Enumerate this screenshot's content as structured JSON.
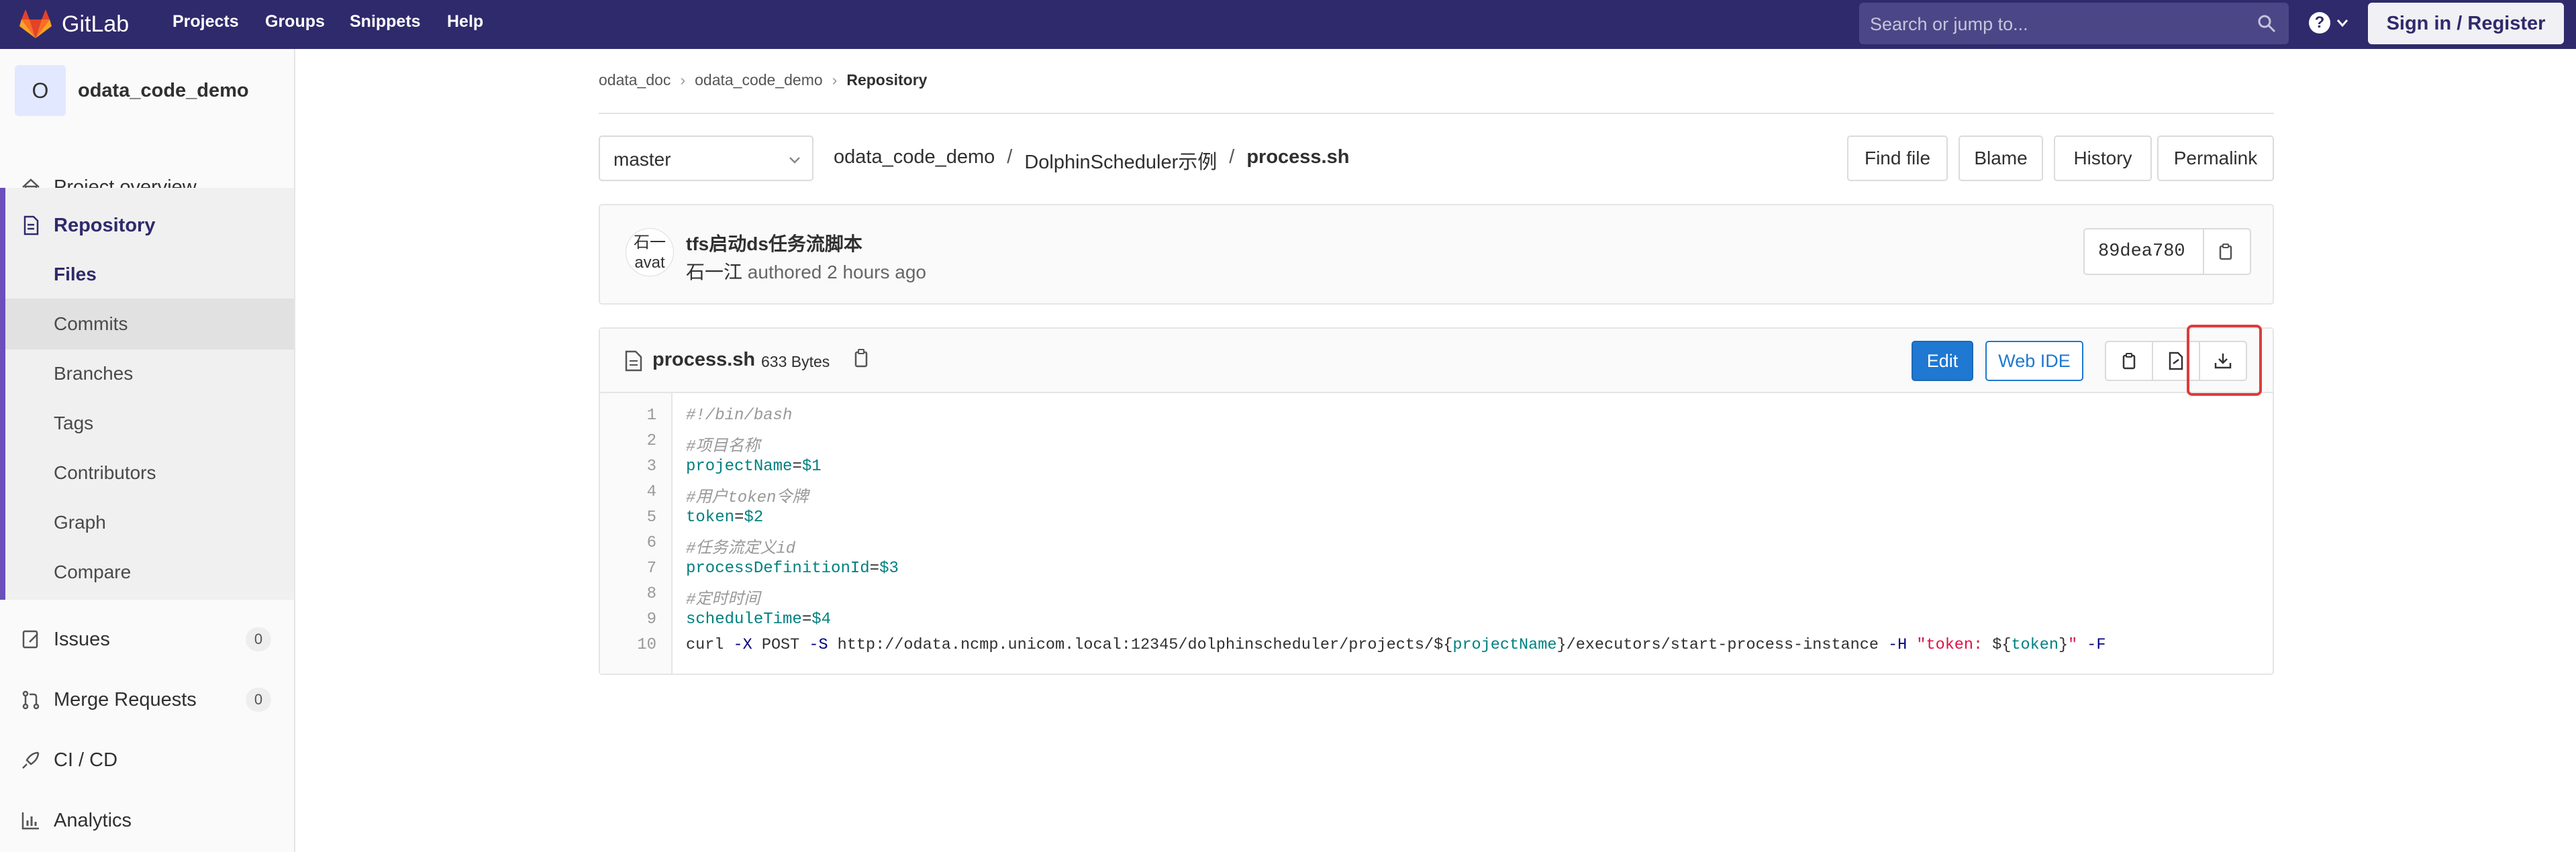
{
  "navbar": {
    "brand": "GitLab",
    "links": [
      "Projects",
      "Groups",
      "Snippets",
      "Help"
    ],
    "search_placeholder": "Search or jump to...",
    "help_glyph": "?",
    "signin_label": "Sign in / Register",
    "colors": {
      "bg": "#2f2a6b",
      "accent": "#fc6d26"
    }
  },
  "sidebar": {
    "project_initial": "O",
    "project_name": "odata_code_demo",
    "overview": "Project overview",
    "repository": "Repository",
    "repo_items": [
      "Files",
      "Commits",
      "Branches",
      "Tags",
      "Contributors",
      "Graph",
      "Compare"
    ],
    "issues": {
      "label": "Issues",
      "count": "0"
    },
    "merge_requests": {
      "label": "Merge Requests",
      "count": "0"
    },
    "cicd": "CI / CD",
    "analytics": "Analytics"
  },
  "breadcrumb": [
    "odata_doc",
    "odata_code_demo",
    "Repository"
  ],
  "toolbar": {
    "branch": "master",
    "path": [
      "odata_code_demo",
      "DolphinScheduler示例",
      "process.sh"
    ],
    "buttons": [
      "Find file",
      "Blame",
      "History",
      "Permalink"
    ]
  },
  "commit": {
    "avatar_text": [
      "石一",
      "avat"
    ],
    "title": "tfs启动ds任务流脚本",
    "author": "石一江",
    "meta": "authored 2 hours ago",
    "sha": "89dea780"
  },
  "file": {
    "name": "process.sh",
    "size": "633 Bytes",
    "edit_label": "Edit",
    "webide_label": "Web IDE",
    "line_numbers": [
      "1",
      "2",
      "3",
      "4",
      "5",
      "6",
      "7",
      "8",
      "9",
      "10"
    ],
    "lines": [
      "#!/bin/bash",
      "#项目名称",
      "projectName=$1",
      "#用户token令牌",
      "token=$2",
      "#任务流定义id",
      "processDefinitionId=$3",
      "#定时时间",
      "scheduleTime=$4",
      "curl -X POST -S http://odata.ncmp.unicom.local:12345/dolphinscheduler/projects/${projectName}/executors/start-process-instance -H \"token: ${token}\" -F"
    ],
    "line10_parts": {
      "curl": "curl ",
      "x": "-X",
      "post": " POST ",
      "s": "-S",
      "url_a": " http://odata.ncmp.unicom.local:12345/dolphinscheduler/projects/${",
      "var1": "projectName",
      "url_b": "}/executors/start-process-instance ",
      "h": "-H",
      "str_a": " \"token: ",
      "dollar": "${",
      "var2": "token",
      "close": "}",
      "quote": "\"",
      "f": " -F"
    },
    "assign": [
      {
        "name": "projectName",
        "value": "$1"
      },
      {
        "name": "token",
        "value": "$2"
      },
      {
        "name": "processDefinitionId",
        "value": "$3"
      },
      {
        "name": "scheduleTime",
        "value": "$4"
      }
    ],
    "comments": [
      "#!/bin/bash",
      "#项目名称",
      "#用户token令牌",
      "#任务流定义id",
      "#定时时间"
    ]
  }
}
